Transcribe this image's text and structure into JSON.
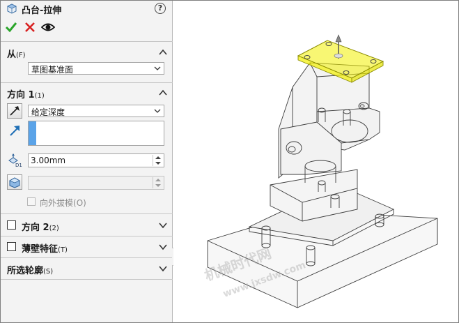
{
  "feature": {
    "title": "凸台-拉伸",
    "help": "?"
  },
  "from": {
    "label": "从",
    "shortcut": "(F)",
    "value": "草图基准面"
  },
  "direction1": {
    "label": "方向 1",
    "shortcut": "(1)",
    "end_condition": "给定深度",
    "depth": "3.00mm",
    "draft_label": "向外拔模",
    "draft_shortcut": "(O)"
  },
  "direction2": {
    "label": "方向 2",
    "shortcut": "(2)"
  },
  "thin_feature": {
    "label": "薄壁特征",
    "shortcut": "(T)"
  },
  "selected_contours": {
    "label": "所选轮廓",
    "shortcut": "(S)"
  },
  "watermark": {
    "line1": "机械时代网",
    "line2": "www.jxsdw.com"
  },
  "colors": {
    "ok": "#2aa52a",
    "cancel": "#d82020",
    "selection": "#5aa3e8",
    "highlight": "#f2f000"
  }
}
